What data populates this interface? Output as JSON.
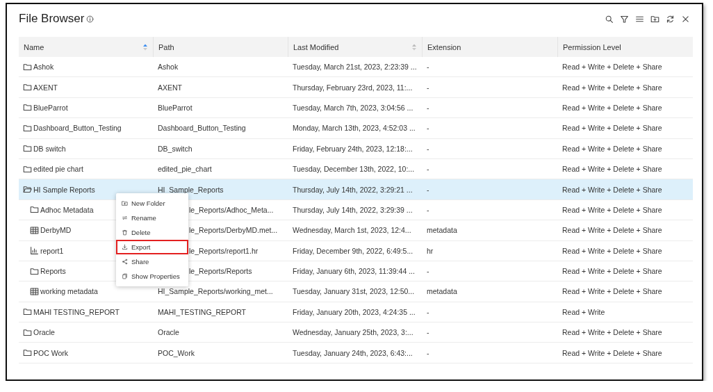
{
  "window": {
    "title": "File Browser"
  },
  "toolbar": [
    {
      "kind": "search"
    },
    {
      "kind": "filter"
    },
    {
      "kind": "menu"
    },
    {
      "kind": "new-folder"
    },
    {
      "kind": "refresh"
    },
    {
      "kind": "close"
    }
  ],
  "table": {
    "columns": [
      {
        "label": "Name",
        "sorted": true
      },
      {
        "label": "Path"
      },
      {
        "label": "Last Modified",
        "sorted": false
      },
      {
        "label": "Extension"
      },
      {
        "label": "Permission Level"
      }
    ],
    "rows": [
      {
        "kind": "folder",
        "name": "Ashok",
        "path": "Ashok",
        "modified": "Tuesday, March 21st, 2023, 2:23:39 ...",
        "extension": "-",
        "permission": "Read + Write + Delete + Share",
        "selected": false
      },
      {
        "kind": "folder",
        "name": "AXENT",
        "path": "AXENT",
        "modified": "Thursday, February 23rd, 2023, 11:...",
        "extension": "-",
        "permission": "Read + Write + Delete + Share",
        "selected": false
      },
      {
        "kind": "folder",
        "name": "BlueParrot",
        "path": "BlueParrot",
        "modified": "Tuesday, March 7th, 2023, 3:04:56 ...",
        "extension": "-",
        "permission": "Read + Write + Delete + Share",
        "selected": false
      },
      {
        "kind": "folder",
        "name": "Dashboard_Button_Testing",
        "path": "Dashboard_Button_Testing",
        "modified": "Monday, March 13th, 2023, 4:52:03 ...",
        "extension": "-",
        "permission": "Read + Write + Delete + Share",
        "selected": false
      },
      {
        "kind": "folder",
        "name": "DB switch",
        "path": "DB_switch",
        "modified": "Friday, February 24th, 2023, 12:18:...",
        "extension": "-",
        "permission": "Read + Write + Delete + Share",
        "selected": false
      },
      {
        "kind": "folder",
        "name": "edited pie chart",
        "path": "edited_pie_chart",
        "modified": "Tuesday, December 13th, 2022, 10:...",
        "extension": "-",
        "permission": "Read + Write + Delete + Share",
        "selected": false
      },
      {
        "kind": "folder",
        "name": "HI Sample Reports",
        "path": "HI_Sample_Reports",
        "modified": "Thursday, July 14th, 2022, 3:29:21 ...",
        "extension": "-",
        "permission": "Read + Write + Delete + Share",
        "selected": true,
        "expanded": true,
        "children": [
          {
            "kind": "folder",
            "name": "Adhoc Metadata",
            "path": "le_Reports/Adhoc_Meta...",
            "path_covered": true,
            "modified": "Thursday, July 14th, 2022, 3:29:39 ...",
            "extension": "-",
            "permission": "Read + Write + Delete + Share",
            "selected": false
          },
          {
            "kind": "table",
            "name": "DerbyMD",
            "path": "le_Reports/DerbyMD.met...",
            "path_covered": true,
            "modified": "Wednesday, March 1st, 2023, 12:4...",
            "extension": "metadata",
            "permission": "Read + Write + Delete + Share",
            "selected": false
          },
          {
            "kind": "report",
            "name": "report1",
            "path": "le_Reports/report1.hr",
            "path_covered": true,
            "modified": "Friday, December 9th, 2022, 6:49:5...",
            "extension": "hr",
            "permission": "Read + Write + Delete + Share",
            "selected": false
          },
          {
            "kind": "folder",
            "name": "Reports",
            "path": "le_Reports/Reports",
            "path_covered": true,
            "modified": "Friday, January 6th, 2023, 11:39:44 ...",
            "extension": "-",
            "permission": "Read + Write + Delete + Share",
            "selected": false
          },
          {
            "kind": "table",
            "name": "working metadata",
            "path": "HI_Sample_Reports/working_met...",
            "modified": "Tuesday, January 31st, 2023, 12:50...",
            "extension": "metadata",
            "permission": "Read + Write + Delete + Share",
            "selected": false
          }
        ]
      },
      {
        "kind": "folder",
        "name": "MAHI TESTING_REPORT",
        "path": "MAHI_TESTING_REPORT",
        "modified": "Friday, January 20th, 2023, 4:24:35 ...",
        "extension": "-",
        "permission": "Read + Write",
        "selected": false
      },
      {
        "kind": "folder",
        "name": "Oracle",
        "path": "Oracle",
        "modified": "Wednesday, January 25th, 2023, 3:...",
        "extension": "-",
        "permission": "Read + Write + Delete + Share",
        "selected": false
      },
      {
        "kind": "folder",
        "name": "POC Work",
        "path": "POC_Work",
        "modified": "Tuesday, January 24th, 2023, 6:43:...",
        "extension": "-",
        "permission": "Read + Write + Delete + Share",
        "selected": false
      }
    ]
  },
  "context_menu": {
    "items": [
      {
        "kind": "new-folder",
        "label": "New Folder",
        "highlighted": false
      },
      {
        "kind": "rename",
        "label": "Rename",
        "highlighted": false
      },
      {
        "kind": "delete",
        "label": "Delete",
        "highlighted": false
      },
      {
        "kind": "export",
        "label": "Export",
        "highlighted": true
      },
      {
        "kind": "share",
        "label": "Share",
        "highlighted": false
      },
      {
        "kind": "properties",
        "label": "Show Properties",
        "highlighted": false
      }
    ]
  }
}
